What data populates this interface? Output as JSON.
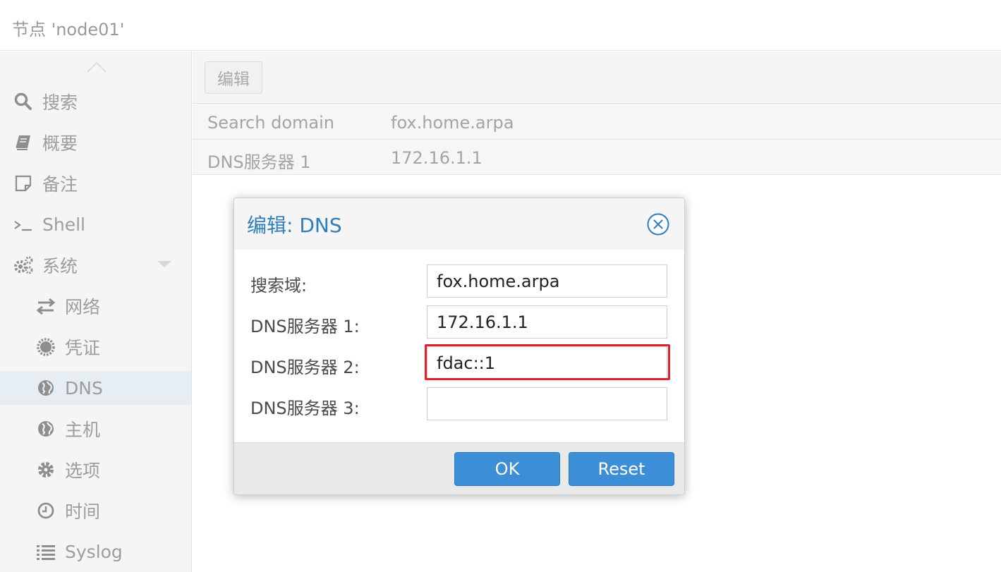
{
  "header": {
    "title": "节点 'node01'"
  },
  "sidebar": {
    "items": [
      {
        "label": "搜索",
        "icon": "search-icon"
      },
      {
        "label": "概要",
        "icon": "book-icon"
      },
      {
        "label": "备注",
        "icon": "note-icon"
      },
      {
        "label": "Shell",
        "icon": "terminal-icon"
      },
      {
        "label": "系统",
        "icon": "gears-icon"
      },
      {
        "label": "网络",
        "icon": "exchange-icon"
      },
      {
        "label": "凭证",
        "icon": "certificate-icon"
      },
      {
        "label": "DNS",
        "icon": "globe-icon",
        "active": true
      },
      {
        "label": "主机",
        "icon": "globe-icon"
      },
      {
        "label": "选项",
        "icon": "gear-icon"
      },
      {
        "label": "时间",
        "icon": "clock-icon"
      },
      {
        "label": "Syslog",
        "icon": "list-icon"
      }
    ]
  },
  "toolbar": {
    "edit_label": "编辑"
  },
  "grid": {
    "rows": [
      {
        "key": "Search domain",
        "value": "fox.home.arpa"
      },
      {
        "key": "DNS服务器 1",
        "value": "172.16.1.1"
      }
    ]
  },
  "dialog": {
    "title": "编辑: DNS",
    "fields": [
      {
        "label": "搜索域:",
        "value": "fox.home.arpa"
      },
      {
        "label": "DNS服务器 1:",
        "value": "172.16.1.1"
      },
      {
        "label": "DNS服务器 2:",
        "value": "fdac::1"
      },
      {
        "label": "DNS服务器 3:",
        "value": ""
      }
    ],
    "ok_label": "OK",
    "reset_label": "Reset"
  },
  "colors": {
    "accent": "#3c8fd6",
    "title_blue": "#2f7ebd",
    "highlight_red": "#e3212b",
    "active_item_bg": "#e6edf3"
  }
}
